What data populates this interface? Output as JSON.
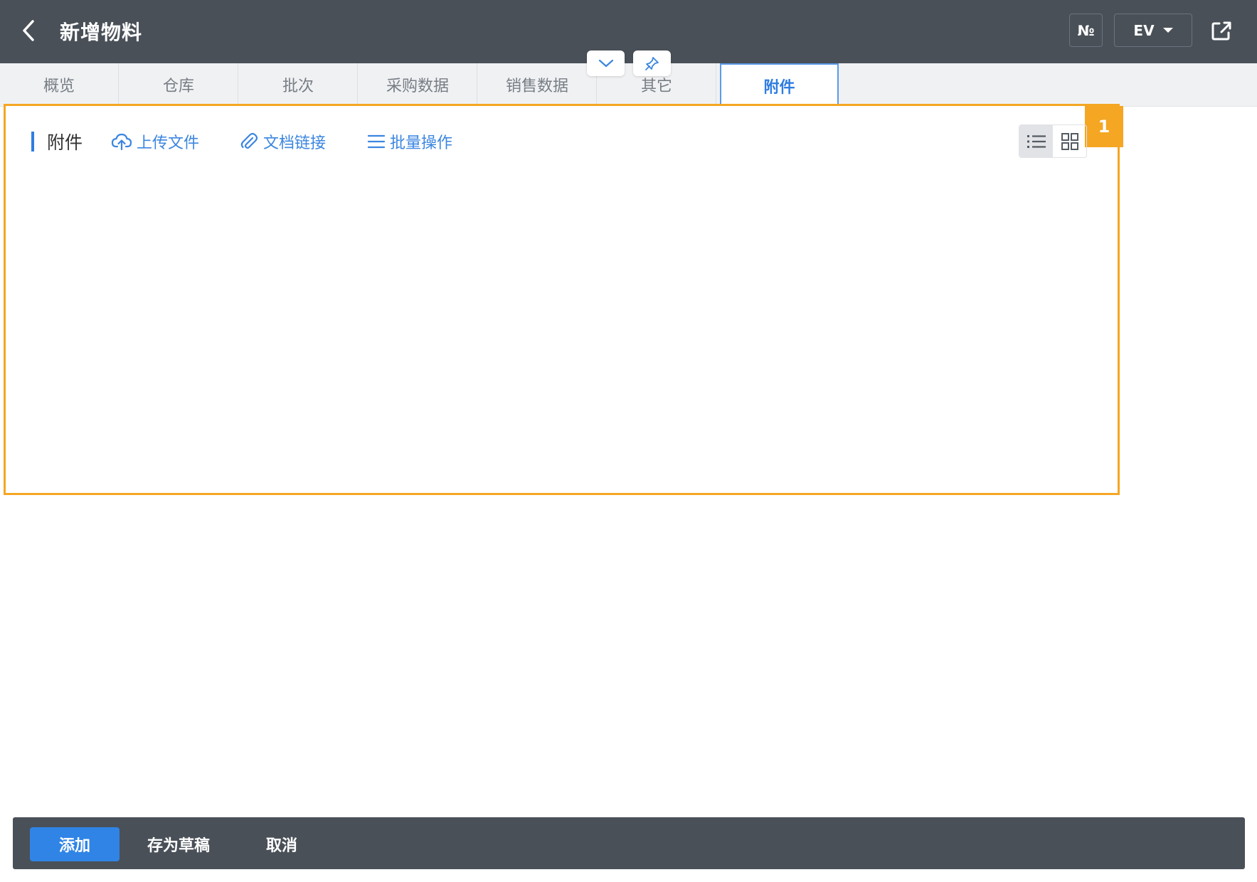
{
  "header": {
    "title": "新增物料",
    "no_label": "№",
    "lang_label": "EV"
  },
  "tabs": [
    {
      "label": "概览"
    },
    {
      "label": "仓库"
    },
    {
      "label": "批次"
    },
    {
      "label": "采购数据"
    },
    {
      "label": "销售数据"
    },
    {
      "label": "其它"
    },
    {
      "label": "附件"
    }
  ],
  "active_tab": "附件",
  "attachments": {
    "badge": "1",
    "section_label": "附件",
    "upload_label": "上传文件",
    "doc_link_label": "文档链接",
    "batch_label": "批量操作",
    "view_modes": [
      "list",
      "grid"
    ],
    "active_view": "list"
  },
  "footer": {
    "add_label": "添加",
    "draft_label": "存为草稿",
    "cancel_label": "取消"
  },
  "colors": {
    "header_bg": "#4a5058",
    "accent": "#2f7de1",
    "highlight": "#f5a623"
  }
}
